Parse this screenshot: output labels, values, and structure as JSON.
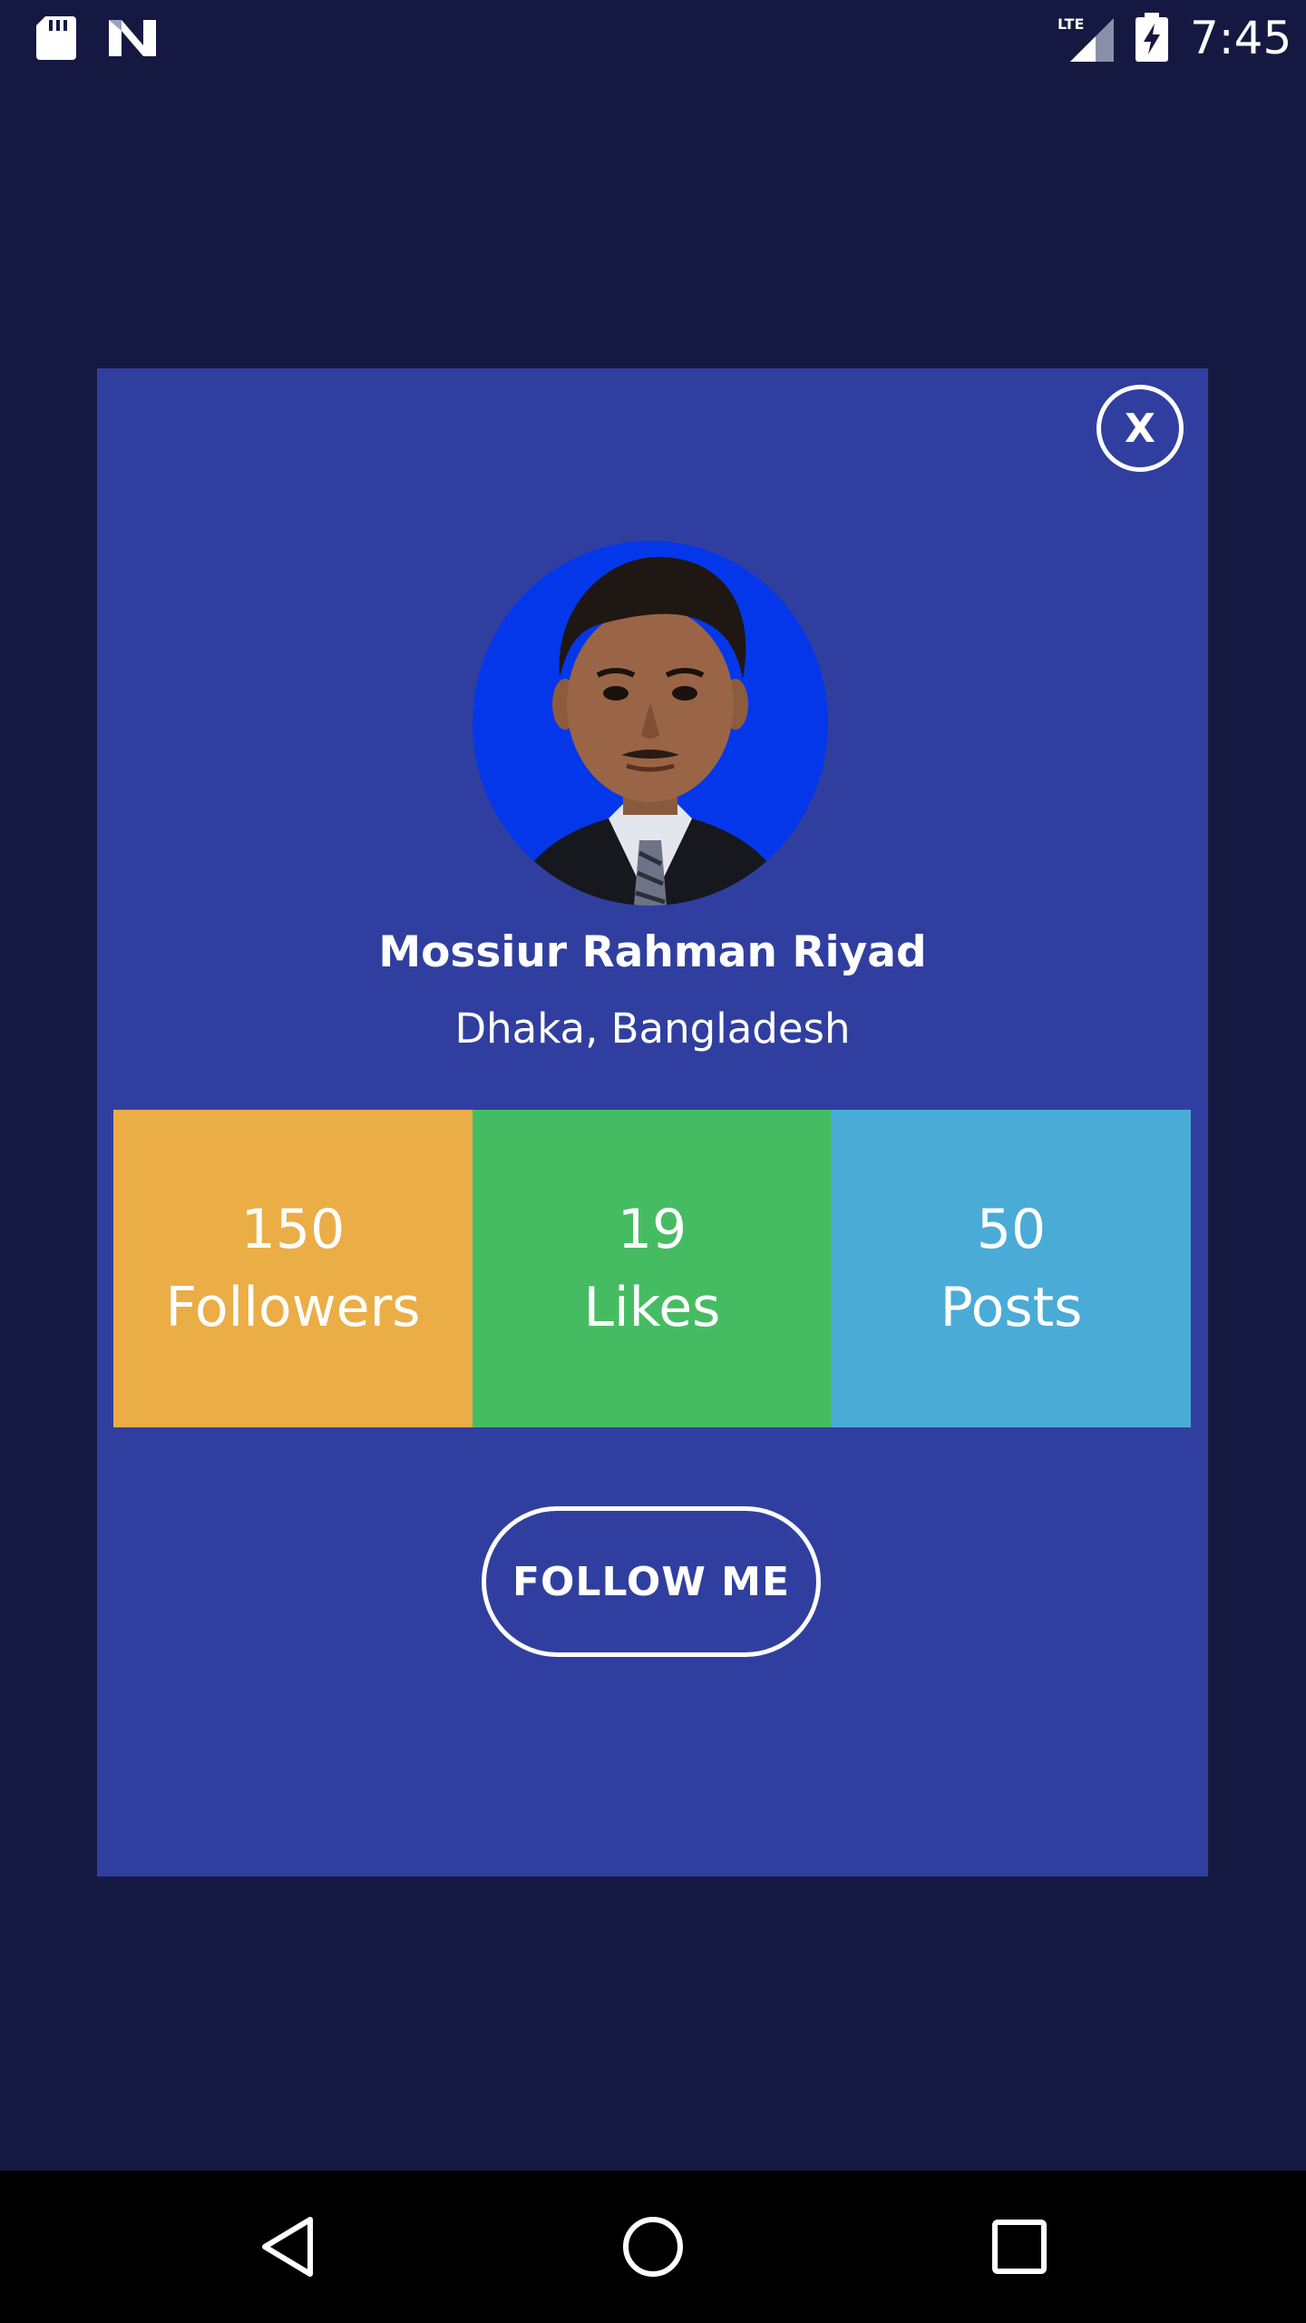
{
  "status_bar": {
    "time": "7:45",
    "network": "LTE",
    "icons": [
      "sd-card-icon",
      "n-logo-icon",
      "lte-signal-icon",
      "battery-charging-icon"
    ]
  },
  "dialog": {
    "close_label": "X",
    "profile": {
      "name": "Mossiur Rahman Riyad",
      "location": "Dhaka, Bangladesh"
    },
    "stats": [
      {
        "value": "150",
        "label": "Followers",
        "color": "#ebad46"
      },
      {
        "value": "19",
        "label": "Likes",
        "color": "#46bc62"
      },
      {
        "value": "50",
        "label": "Posts",
        "color": "#4aabd7"
      }
    ],
    "follow_label": "FOLLOW ME"
  },
  "colors": {
    "background": "#151941",
    "dialog": "#303f9f",
    "avatar_bg": "#0537ea"
  },
  "nav_bar": {
    "icons": [
      "back-icon",
      "home-icon",
      "recents-icon"
    ]
  }
}
